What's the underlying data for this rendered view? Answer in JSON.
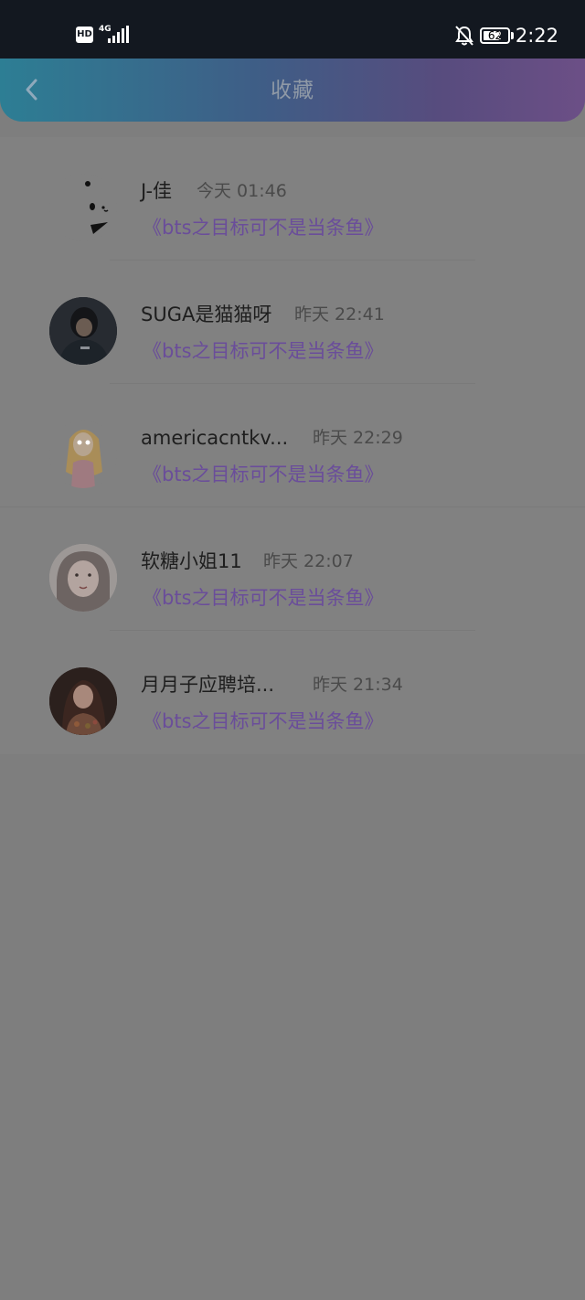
{
  "status_bar": {
    "hd": "HD",
    "network": "4G",
    "battery": "62",
    "time": "2:22",
    "icons": [
      "signal-icon",
      "bell-muted-icon",
      "battery-icon"
    ]
  },
  "header": {
    "title": "收藏",
    "back_icon": "chevron-left-icon"
  },
  "favorites": [
    {
      "name": "J-佳",
      "time": "今天 01:46",
      "title": "《bts之目标可不是当条鱼》",
      "avatar": "panda-avatar"
    },
    {
      "name": "SUGA是猫猫呀",
      "time": "昨天 22:41",
      "title": "《bts之目标可不是当条鱼》",
      "avatar": "dark-portrait-avatar"
    },
    {
      "name": "americacntkv...",
      "time": "昨天 22:29",
      "title": "《bts之目标可不是当条鱼》",
      "avatar": "cartoon-girl-avatar"
    },
    {
      "name": "软糖小姐11",
      "time": "昨天 22:07",
      "title": "《bts之目标可不是当条鱼》",
      "avatar": "girl-face-avatar"
    },
    {
      "name": "月月子应聘培...",
      "time": "昨天 21:34",
      "title": "《bts之目标可不是当条鱼》",
      "avatar": "girl-photo-avatar"
    }
  ],
  "colors": {
    "header_gradient_start": "#2d7e94",
    "header_gradient_end": "#6c4f86",
    "link_color": "#6a4d9a",
    "overlay_gray": "#7e7e7e"
  }
}
